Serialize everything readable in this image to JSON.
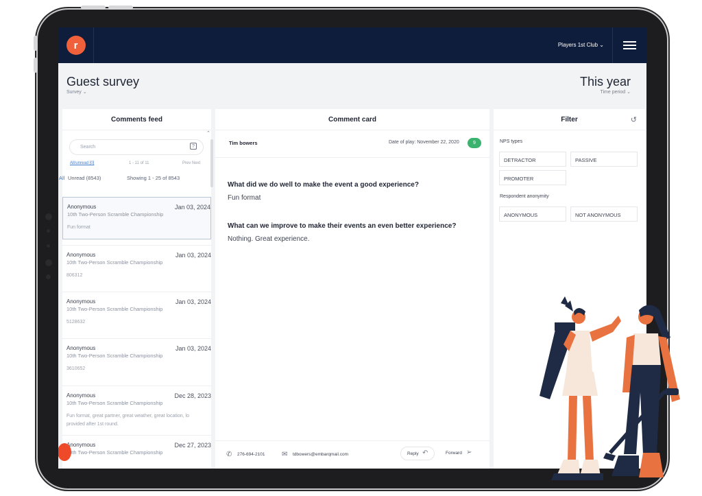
{
  "nav": {
    "logo_letter": "r",
    "club_selector": "Players 1st Club ⌄"
  },
  "header": {
    "title": "Guest survey",
    "subtitle": "Survey ⌄",
    "period": "This year",
    "period_sub": "Time period ⌄"
  },
  "feed": {
    "title": "Comments feed",
    "search_placeholder": "Search",
    "filter_link": "All/unread [0]",
    "count": "1 - 11 of 11",
    "pager": "Prev Next",
    "tab_all": "All",
    "tab_unread": "Unread (8543)",
    "showing": "Showing 1 - 25 of 8543",
    "items": [
      {
        "name": "Anonymous",
        "date": "Jan 03, 2024",
        "event": "10th Two-Person Scramble Championship",
        "text": "Fun format"
      },
      {
        "name": "Anonymous",
        "date": "Jan 03, 2024",
        "event": "10th Two-Person Scramble Championship",
        "text": "806312"
      },
      {
        "name": "Anonymous",
        "date": "Jan 03, 2024",
        "event": "10th Two-Person Scramble Championship",
        "text": "5128632"
      },
      {
        "name": "Anonymous",
        "date": "Jan 03, 2024",
        "event": "10th Two-Person Scramble Championship",
        "text": "3610652"
      },
      {
        "name": "Anonymous",
        "date": "Dec 28, 2023",
        "event": "10th Two-Person Scramble Championship",
        "text": "Fun format, great partner, great weather, great location, lo",
        "text2": "provided after 1st round."
      },
      {
        "name": "Anonymous",
        "date": "Dec 27, 2023",
        "event": "10th Two-Person Scramble Championship",
        "text": ""
      }
    ]
  },
  "card": {
    "title": "Comment card",
    "name": "Tim bowers",
    "date": "Date of play: November 22, 2020",
    "score": "9",
    "q1": "What did we do well to make the event a good experience?",
    "a1": "Fun format",
    "q2": "What can we improve to make their events an even better experience?",
    "a2": "Nothing. Great experience.",
    "phone": "276-694-2101",
    "email": "tdbowers@embarqmail.com",
    "reply": "Reply",
    "forward": "Forward"
  },
  "filter": {
    "title": "Filter",
    "nps_label": "NPS types",
    "nps": [
      "DETRACTOR",
      "PASSIVE",
      "PROMOTER"
    ],
    "anon_label": "Respondent anonymity",
    "anon": [
      "ANONYMOUS",
      "NOT ANONYMOUS"
    ]
  },
  "colors": {
    "nav": "#0f1d3d",
    "accent": "#f0603a",
    "score": "#3bb26d",
    "link": "#3f79c9"
  }
}
